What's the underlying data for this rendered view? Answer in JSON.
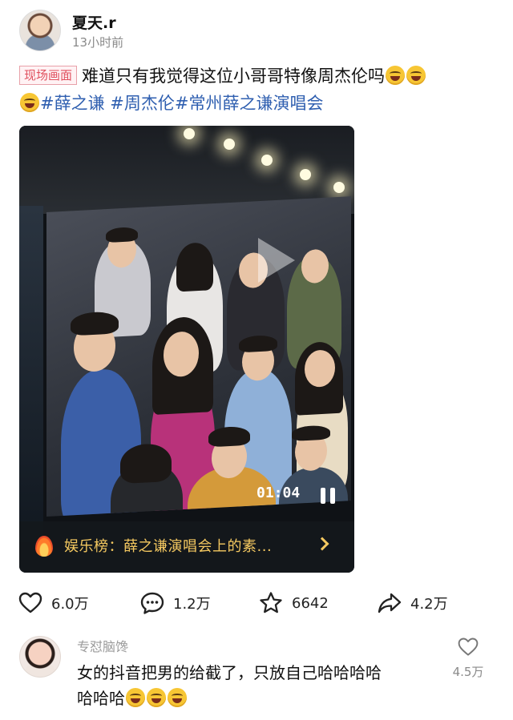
{
  "post": {
    "username": "夏天.r",
    "time": "13小时前",
    "tag_live": "现场画面",
    "text": "难道只有我觉得这位小哥哥特像周杰伦吗",
    "hashtags": "#薛之谦 #周杰伦#常州薛之谦演唱会"
  },
  "media": {
    "video_time": "01:04",
    "banner_prefix": "娱乐榜：",
    "banner_title": "薛之谦演唱会上的素...",
    "icons": [
      "fire-icon",
      "chevron-right-icon",
      "pause-icon",
      "play-icon"
    ]
  },
  "actions": {
    "like_count": "6.0万",
    "comment_count": "1.2万",
    "favorite_count": "6642",
    "share_count": "4.2万"
  },
  "comment": {
    "username": "专怼脑馋",
    "text_line1": "女的抖音把男的给截了，只放自己哈哈哈哈",
    "text_line2": "哈哈哈",
    "like_count": "4.5万"
  }
}
